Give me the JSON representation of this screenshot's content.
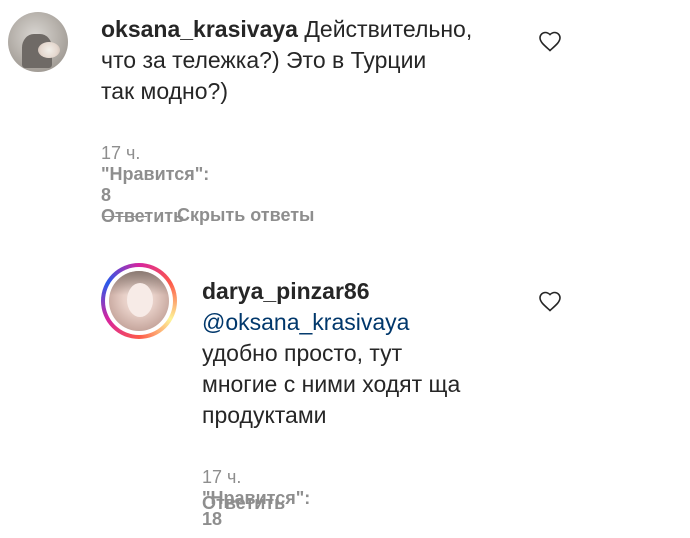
{
  "comments": [
    {
      "username": "oksana_krasivaya",
      "text": "Действительно, что за тележка?) Это в Турции так модно?)",
      "text_lines": [
        "Действительно,",
        "что за тележка?) Это в Турции",
        "так модно?)"
      ],
      "time": "17 ч.",
      "likes": "\"Нравится\": 8",
      "reply_label": "Ответить"
    }
  ],
  "hide_replies_label": "Скрыть ответы",
  "replies": [
    {
      "username": "darya_pinzar86",
      "mention": "@oksana_krasivaya",
      "text_lines": [
        "удобно просто, тут",
        "многие с ними ходят ща",
        "продуктами"
      ],
      "time": "17 ч.",
      "likes": "\"Нравится\": 18",
      "reply_label": "Ответить"
    }
  ],
  "icons": {
    "like": "heart-outline-icon"
  },
  "colors": {
    "text": "#262626",
    "meta": "#8e8e8e",
    "mention": "#00376b"
  }
}
